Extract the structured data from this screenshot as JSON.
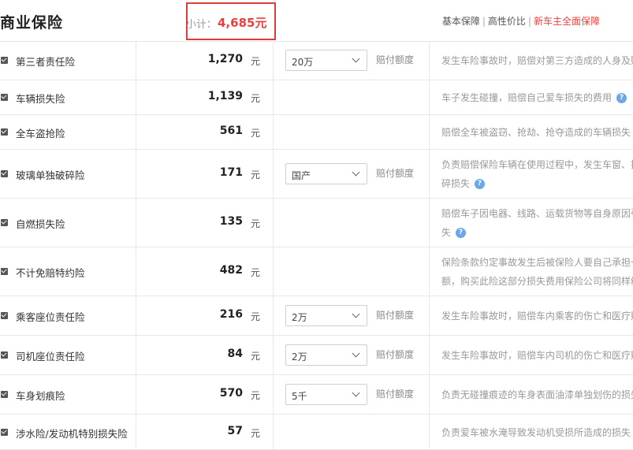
{
  "header": {
    "title": "商业保险",
    "subtotal_label": "小计：",
    "subtotal_value": "4,685元",
    "tabs": [
      "基本保障",
      "高性价比",
      "新车主全面保障"
    ]
  },
  "rows": [
    {
      "name": "第三者责任险",
      "price": "1,270",
      "unit": "元",
      "select": "20万",
      "amount_label": "赔付额度",
      "desc": [
        "发生车险事故时，赔偿对第三方造成的人身及财"
      ]
    },
    {
      "name": "车辆损失险",
      "price": "1,139",
      "unit": "元",
      "select": "",
      "amount_label": "",
      "desc": [
        "车子发生碰撞，赔偿自己爱车损失的费用"
      ]
    },
    {
      "name": "全车盗抢险",
      "price": "561",
      "unit": "元",
      "select": "",
      "amount_label": "",
      "desc": [
        "赔偿全车被盗窃、抢劫、抢夺造成的车辆损失"
      ]
    },
    {
      "name": "玻璃单独破碎险",
      "price": "171",
      "unit": "元",
      "select": "国产",
      "amount_label": "赔付额度",
      "desc": [
        "负责赔偿保险车辆在使用过程中，发生车窗、挡",
        "碎损失"
      ]
    },
    {
      "name": "自燃损失险",
      "price": "135",
      "unit": "元",
      "select": "",
      "amount_label": "",
      "desc": [
        "赔偿车子因电器、线路、运载货物等自身原因引",
        "失"
      ]
    },
    {
      "name": "不计免赔特约险",
      "price": "482",
      "unit": "元",
      "select": "",
      "amount_label": "",
      "desc": [
        "保险条款约定事故发生后被保险人要自己承担一",
        "额，购买此险这部分损失费用保险公司将同样给"
      ]
    },
    {
      "name": "乘客座位责任险",
      "price": "216",
      "unit": "元",
      "select": "2万",
      "amount_label": "赔付额度",
      "desc": [
        "发生车险事故时，赔偿车内乘客的伤亡和医疗赔"
      ]
    },
    {
      "name": "司机座位责任险",
      "price": "84",
      "unit": "元",
      "select": "2万",
      "amount_label": "赔付额度",
      "desc": [
        "发生车险事故时，赔偿车内司机的伤亡和医疗赔"
      ]
    },
    {
      "name": "车身划痕险",
      "price": "570",
      "unit": "元",
      "select": "5千",
      "amount_label": "赔付额度",
      "desc": [
        "负责无碰撞痕迹的车身表面油漆单独划伤的损失"
      ]
    },
    {
      "name": "涉水险/发动机特别损失险",
      "price": "57",
      "unit": "元",
      "select": "",
      "amount_label": "",
      "desc": [
        "负责爱车被水淹导致发动机受损所造成的损失"
      ]
    }
  ]
}
